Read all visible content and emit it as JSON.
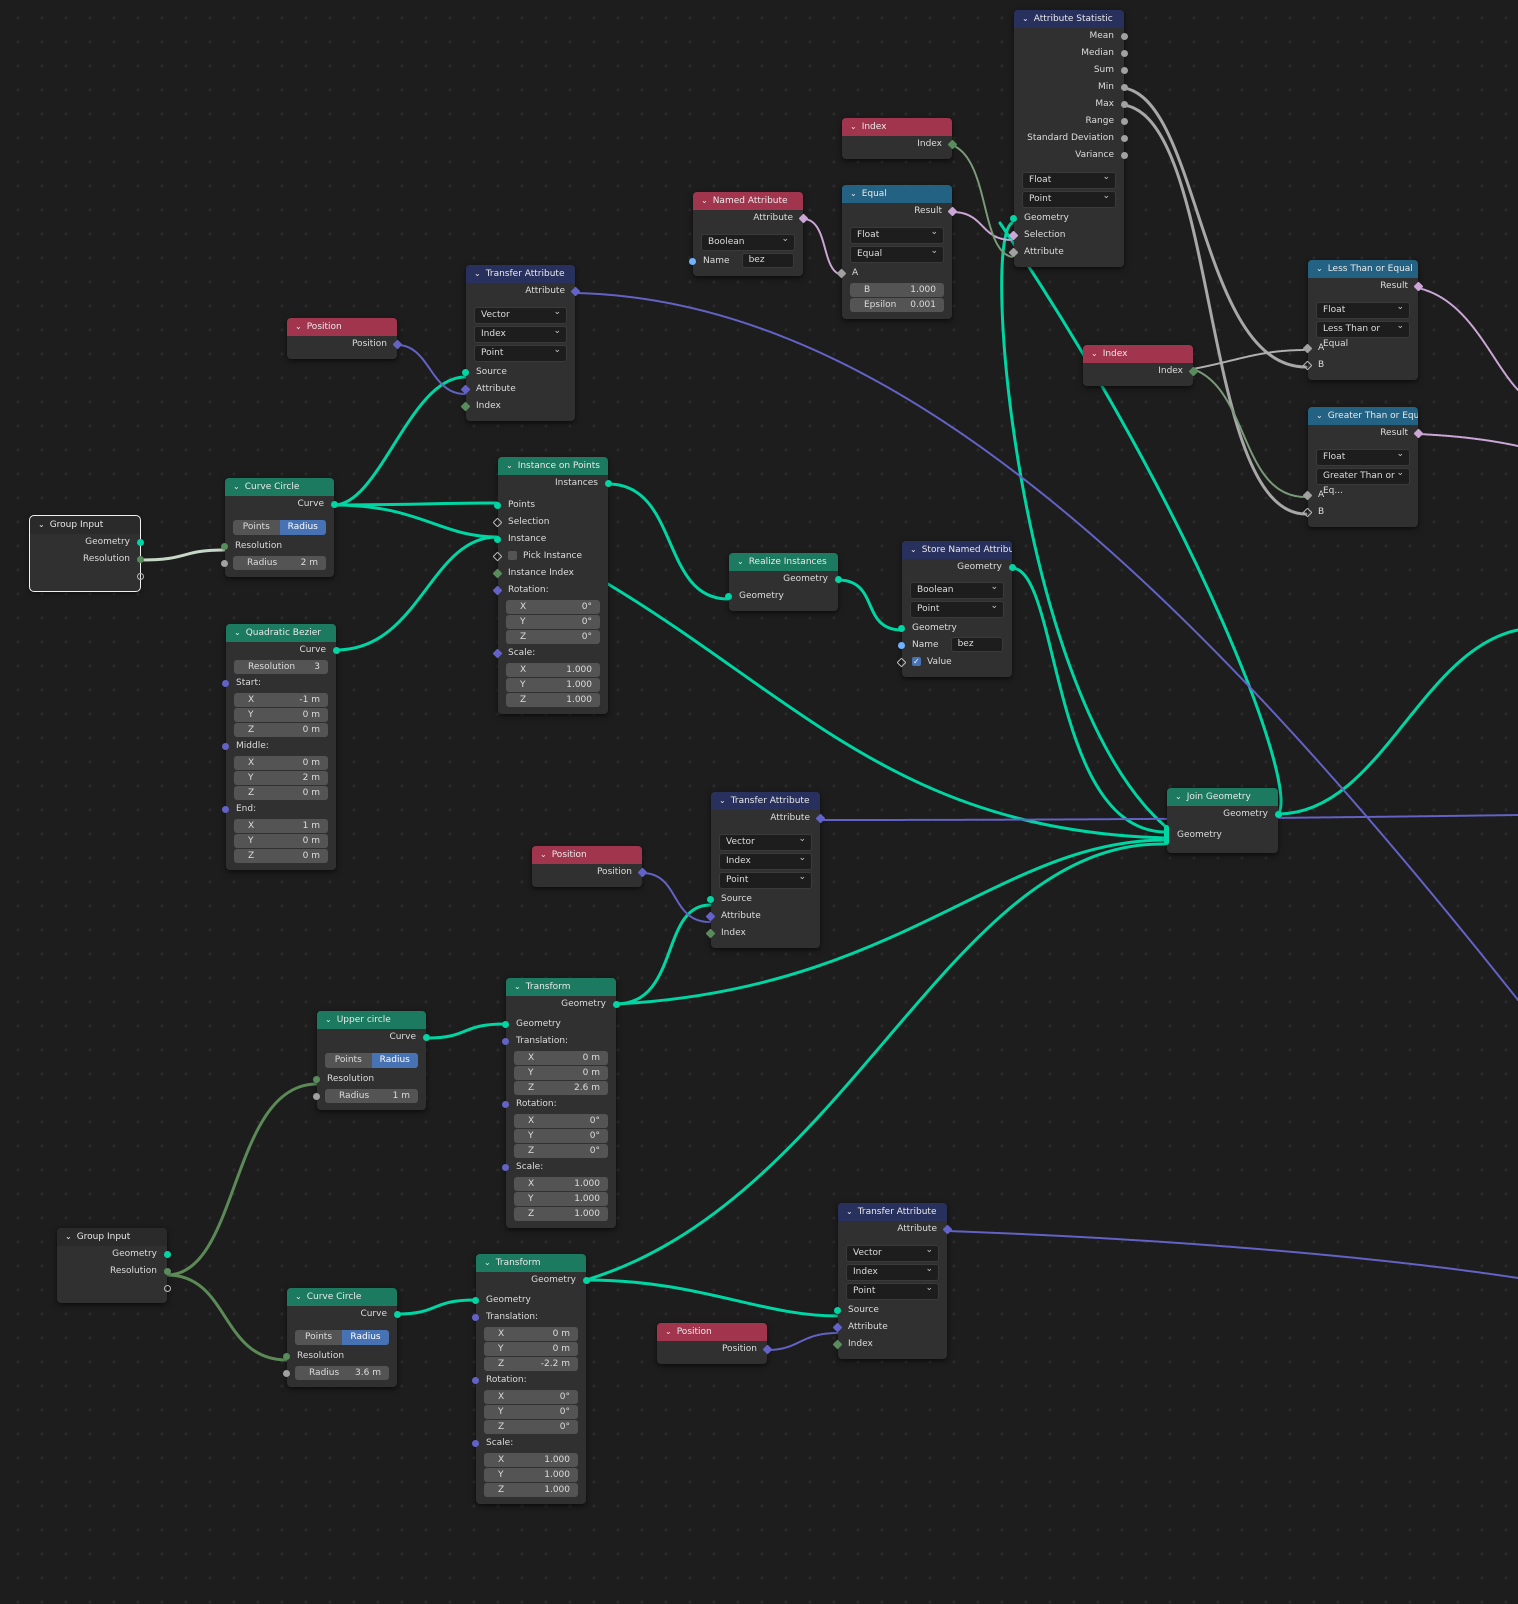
{
  "editor": "Geometry Node Editor",
  "colors": {
    "geometry_header": "#1b7a5f",
    "input_header": "#a1354d",
    "attribute_header": "#28305e",
    "converter_header": "#246283",
    "geometry_socket": "#00d6a3",
    "vector_socket": "#6363c7",
    "integer_socket": "#598c5c",
    "boolean_socket": "#cca6d6",
    "float_socket": "#a1a1a1",
    "string_socket": "#70b2ff",
    "active_toggle": "#4772b3"
  },
  "nodes": {
    "attribute_statistic": {
      "title": "Attribute Statistic",
      "outputs": [
        "Mean",
        "Median",
        "Sum",
        "Min",
        "Max",
        "Range",
        "Standard Deviation",
        "Variance"
      ],
      "dropdowns": [
        "Float",
        "Point"
      ],
      "inputs": [
        "Geometry",
        "Selection",
        "Attribute"
      ]
    },
    "index_1": {
      "title": "Index",
      "output": "Index"
    },
    "equal": {
      "title": "Equal",
      "output": "Result",
      "dropdowns": [
        "Float",
        "Equal"
      ],
      "input_a": "A",
      "b_label": "B",
      "b_value": "1.000",
      "epsilon_label": "Epsilon",
      "epsilon_value": "0.001"
    },
    "named_attribute": {
      "title": "Named Attribute",
      "output": "Attribute",
      "dropdown": "Boolean",
      "name_label": "Name",
      "name_value": "bez"
    },
    "less_than_or_equal": {
      "title": "Less Than or Equal",
      "output": "Result",
      "dropdowns": [
        "Float",
        "Less Than or Equal"
      ],
      "inputs": [
        "A",
        "B"
      ]
    },
    "index_2": {
      "title": "Index",
      "output": "Index"
    },
    "greater_than_or_equal": {
      "title": "Greater Than or Equal",
      "output": "Result",
      "dropdowns": [
        "Float",
        "Greater Than or Eq..."
      ],
      "inputs": [
        "A",
        "B"
      ]
    },
    "transfer_attribute_1": {
      "title": "Transfer Attribute",
      "output": "Attribute",
      "dropdowns": [
        "Vector",
        "Index",
        "Point"
      ],
      "inputs": [
        "Source",
        "Attribute",
        "Index"
      ]
    },
    "position_1": {
      "title": "Position",
      "output": "Position"
    },
    "group_input_1": {
      "title": "Group Input",
      "outputs": [
        "Geometry",
        "Resolution"
      ]
    },
    "curve_circle_1": {
      "title": "Curve Circle",
      "output": "Curve",
      "toggle": [
        "Points",
        "Radius"
      ],
      "resolution_label": "Resolution",
      "radius_label": "Radius",
      "radius_value": "2 m"
    },
    "quadratic_bezier": {
      "title": "Quadratic Bezier",
      "output": "Curve",
      "resolution_label": "Resolution",
      "resolution_value": "3",
      "start_label": "Start:",
      "start": [
        [
          "X",
          "-1 m"
        ],
        [
          "Y",
          "0 m"
        ],
        [
          "Z",
          "0 m"
        ]
      ],
      "middle_label": "Middle:",
      "middle": [
        [
          "X",
          "0 m"
        ],
        [
          "Y",
          "2 m"
        ],
        [
          "Z",
          "0 m"
        ]
      ],
      "end_label": "End:",
      "end": [
        [
          "X",
          "1 m"
        ],
        [
          "Y",
          "0 m"
        ],
        [
          "Z",
          "0 m"
        ]
      ]
    },
    "instance_on_points": {
      "title": "Instance on Points",
      "output": "Instances",
      "inputs": [
        "Points",
        "Selection",
        "Instance"
      ],
      "pick_instance": "Pick Instance",
      "pick_instance_checked": false,
      "instance_index": "Instance Index",
      "rotation_label": "Rotation:",
      "rotation": [
        [
          "X",
          "0°"
        ],
        [
          "Y",
          "0°"
        ],
        [
          "Z",
          "0°"
        ]
      ],
      "scale_label": "Scale:",
      "scale": [
        [
          "X",
          "1.000"
        ],
        [
          "Y",
          "1.000"
        ],
        [
          "Z",
          "1.000"
        ]
      ]
    },
    "realize_instances": {
      "title": "Realize Instances",
      "output": "Geometry",
      "input": "Geometry"
    },
    "store_named_attribute": {
      "title": "Store Named Attribute",
      "output": "Geometry",
      "dropdowns": [
        "Boolean",
        "Point"
      ],
      "input_geometry": "Geometry",
      "name_label": "Name",
      "name_value": "bez",
      "value_label": "Value",
      "value_checked": true
    },
    "join_geometry": {
      "title": "Join Geometry",
      "output": "Geometry",
      "input": "Geometry"
    },
    "transfer_attribute_2": {
      "title": "Transfer Attribute",
      "output": "Attribute",
      "dropdowns": [
        "Vector",
        "Index",
        "Point"
      ],
      "inputs": [
        "Source",
        "Attribute",
        "Index"
      ]
    },
    "position_2": {
      "title": "Position",
      "output": "Position"
    },
    "upper_circle": {
      "title": "Upper circle",
      "output": "Curve",
      "toggle": [
        "Points",
        "Radius"
      ],
      "resolution_label": "Resolution",
      "radius_label": "Radius",
      "radius_value": "1 m"
    },
    "transform_1": {
      "title": "Transform",
      "output": "Geometry",
      "input": "Geometry",
      "translation_label": "Translation:",
      "translation": [
        [
          "X",
          "0 m"
        ],
        [
          "Y",
          "0 m"
        ],
        [
          "Z",
          "2.6 m"
        ]
      ],
      "rotation_label": "Rotation:",
      "rotation": [
        [
          "X",
          "0°"
        ],
        [
          "Y",
          "0°"
        ],
        [
          "Z",
          "0°"
        ]
      ],
      "scale_label": "Scale:",
      "scale": [
        [
          "X",
          "1.000"
        ],
        [
          "Y",
          "1.000"
        ],
        [
          "Z",
          "1.000"
        ]
      ]
    },
    "group_input_2": {
      "title": "Group Input",
      "outputs": [
        "Geometry",
        "Resolution"
      ]
    },
    "curve_circle_2": {
      "title": "Curve Circle",
      "output": "Curve",
      "toggle": [
        "Points",
        "Radius"
      ],
      "resolution_label": "Resolution",
      "radius_label": "Radius",
      "radius_value": "3.6 m"
    },
    "transform_2": {
      "title": "Transform",
      "output": "Geometry",
      "input": "Geometry",
      "translation_label": "Translation:",
      "translation": [
        [
          "X",
          "0 m"
        ],
        [
          "Y",
          "0 m"
        ],
        [
          "Z",
          "-2.2 m"
        ]
      ],
      "rotation_label": "Rotation:",
      "rotation": [
        [
          "X",
          "0°"
        ],
        [
          "Y",
          "0°"
        ],
        [
          "Z",
          "0°"
        ]
      ],
      "scale_label": "Scale:",
      "scale": [
        [
          "X",
          "1.000"
        ],
        [
          "Y",
          "1.000"
        ],
        [
          "Z",
          "1.000"
        ]
      ]
    },
    "transfer_attribute_3": {
      "title": "Transfer Attribute",
      "output": "Attribute",
      "dropdowns": [
        "Vector",
        "Index",
        "Point"
      ],
      "inputs": [
        "Source",
        "Attribute",
        "Index"
      ]
    },
    "position_3": {
      "title": "Position",
      "output": "Position"
    }
  }
}
